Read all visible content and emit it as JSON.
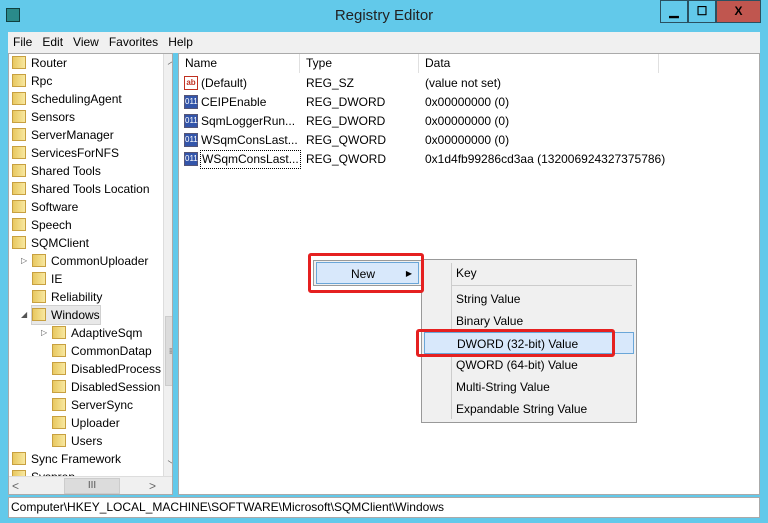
{
  "window": {
    "title": "Registry Editor",
    "minimize": "▁",
    "maximize": "☐",
    "close": "X",
    "close_color": "#c0564f",
    "titlebar_color": "#62c9ea"
  },
  "menubar": [
    "File",
    "Edit",
    "View",
    "Favorites",
    "Help"
  ],
  "tree": [
    {
      "label": "Router",
      "level": 0
    },
    {
      "label": "Rpc",
      "level": 0
    },
    {
      "label": "SchedulingAgent",
      "level": 0
    },
    {
      "label": "Sensors",
      "level": 0
    },
    {
      "label": "ServerManager",
      "level": 0
    },
    {
      "label": "ServicesForNFS",
      "level": 0
    },
    {
      "label": "Shared Tools",
      "level": 0
    },
    {
      "label": "Shared Tools Location",
      "level": 0
    },
    {
      "label": "Software",
      "level": 0
    },
    {
      "label": "Speech",
      "level": 0
    },
    {
      "label": "SQMClient",
      "level": 0,
      "expander": "expanded"
    },
    {
      "label": "CommonUploader",
      "level": 1,
      "expander": "collapsed"
    },
    {
      "label": "IE",
      "level": 1
    },
    {
      "label": "Reliability",
      "level": 1
    },
    {
      "label": "Windows",
      "level": 1,
      "expander": "expanded",
      "selected": true
    },
    {
      "label": "AdaptiveSqm",
      "level": 2,
      "expander": "collapsed"
    },
    {
      "label": "CommonDatap",
      "level": 2
    },
    {
      "label": "DisabledProcess",
      "level": 2
    },
    {
      "label": "DisabledSession",
      "level": 2
    },
    {
      "label": "ServerSync",
      "level": 2
    },
    {
      "label": "Uploader",
      "level": 2
    },
    {
      "label": "Users",
      "level": 2
    },
    {
      "label": "Sync Framework",
      "level": 0
    },
    {
      "label": "Sysprep",
      "level": 0
    }
  ],
  "list": {
    "columns": [
      "Name",
      "Type",
      "Data"
    ],
    "rows": [
      {
        "icon": "string-value-icon",
        "name": "(Default)",
        "type": "REG_SZ",
        "data": "(value not set)"
      },
      {
        "icon": "binary-value-icon",
        "name": "CEIPEnable",
        "type": "REG_DWORD",
        "data": "0x00000000 (0)"
      },
      {
        "icon": "binary-value-icon",
        "name": "SqmLoggerRun...",
        "type": "REG_DWORD",
        "data": "0x00000000 (0)"
      },
      {
        "icon": "binary-value-icon",
        "name": "WSqmConsLast...",
        "type": "REG_QWORD",
        "data": "0x00000000 (0)"
      },
      {
        "icon": "binary-value-icon",
        "name": "WSqmConsLast...",
        "type": "REG_QWORD",
        "data": "0x1d4fb99286cd3aa (132006924327375786)"
      }
    ]
  },
  "context_menu": {
    "new_label": "New",
    "submenu": [
      "Key",
      "String Value",
      "Binary Value",
      "DWORD (32-bit) Value",
      "QWORD (64-bit) Value",
      "Multi-String Value",
      "Expandable String Value"
    ],
    "highlighted": "DWORD (32-bit) Value",
    "annotation_color": "#e52020"
  },
  "status": "Computer\\HKEY_LOCAL_MACHINE\\SOFTWARE\\Microsoft\\SQMClient\\Windows"
}
